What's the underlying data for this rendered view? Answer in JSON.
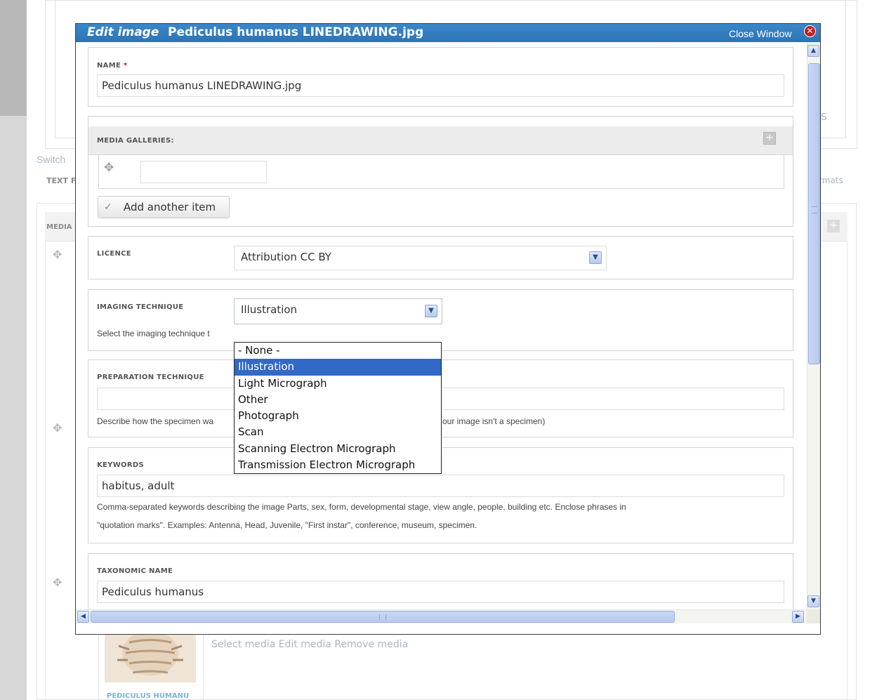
{
  "background": {
    "switch_text": "Switch",
    "text_format_label": "TEXT F",
    "formats_text": "rmats",
    "media_label": "MEDIA",
    "resize_hint": "S",
    "media_actions": "Select media Edit media Remove media",
    "thumb_caption": "PEDICULUS HUMANU"
  },
  "dialog": {
    "title_prefix": "Edit image",
    "title_name": "Pediculus humanus LINEDRAWING.jpg",
    "close_label": "Close Window",
    "close_icon": "✕"
  },
  "name_field": {
    "label": "NAME",
    "required_mark": "*",
    "value": "Pediculus humanus  LINEDRAWING.jpg"
  },
  "media_galleries": {
    "label": "MEDIA GALLERIES:",
    "handle_icon": "✥",
    "add_icon": "+",
    "input_value": "",
    "add_another_label": "Add another item",
    "check_icon": "✓"
  },
  "licence": {
    "label": "LICENCE",
    "value": "Attribution CC BY",
    "arrow": "▼"
  },
  "imaging_technique": {
    "label": "IMAGING TECHNIQUE",
    "value": "Illustration",
    "arrow": "▼",
    "description": "Select the imaging technique t",
    "options": [
      "- None -",
      "Illustration",
      "Light Micrograph",
      "Other",
      "Photograph",
      "Scan",
      "Scanning Electron Micrograph",
      "Transmission Electron Micrograph"
    ],
    "selected_index": 1
  },
  "preparation_technique": {
    "label": "PREPARATION TECHNIQUE",
    "value": "",
    "description_left": "Describe how the specimen wa",
    "description_right": "our image isn't a specimen)"
  },
  "keywords": {
    "label": "KEYWORDS",
    "value": "habitus, adult",
    "description_line1": "Comma-separated keywords describing the image Parts, sex, form, developmental stage, view angle, people, building etc. Enclose phrases in",
    "description_line2": "\"quotation marks\". Examples: Antenna, Head, Juvenile, \"First instar\", conference, museum, specimen."
  },
  "taxonomic_name": {
    "label": "TAXONOMIC NAME",
    "value": "Pediculus humanus"
  },
  "scrollbars": {
    "up": "▲",
    "down": "▼",
    "left": "◀",
    "right": "▶"
  }
}
